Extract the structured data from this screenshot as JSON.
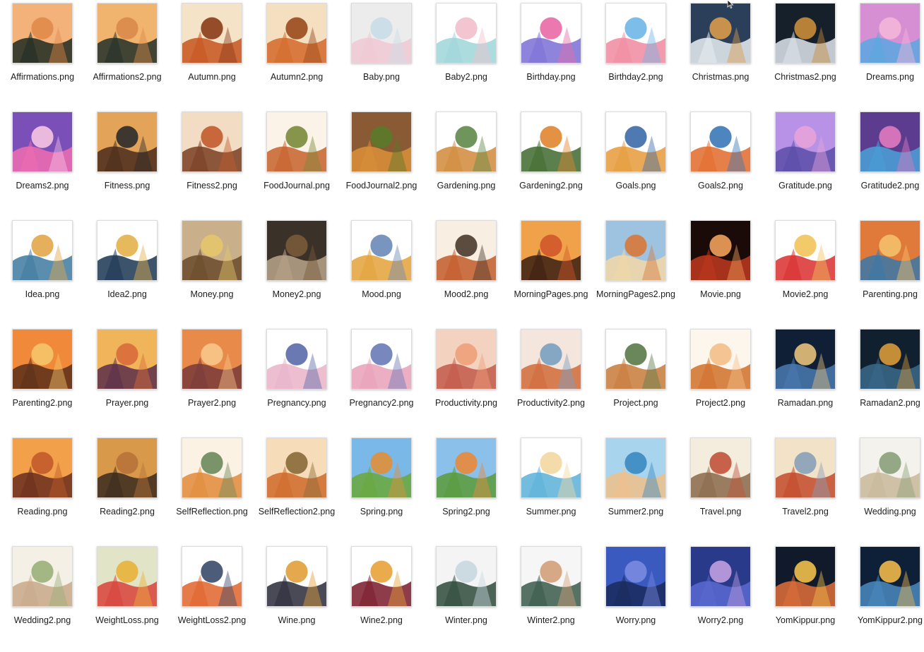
{
  "files": [
    {
      "name": "Affirmations.png",
      "c": [
        "#f2b27a",
        "#1e2a22",
        "#e08a4a"
      ]
    },
    {
      "name": "Affirmations2.png",
      "c": [
        "#f0b46e",
        "#223029",
        "#d9894a"
      ]
    },
    {
      "name": "Autumn.png",
      "c": [
        "#f5e3c8",
        "#c7531f",
        "#8a3b17"
      ]
    },
    {
      "name": "Autumn2.png",
      "c": [
        "#f4dfc1",
        "#d36a2a",
        "#9a4a1c"
      ]
    },
    {
      "name": "Baby.png",
      "c": [
        "#ececec",
        "#f0c9d3",
        "#c9dde8"
      ]
    },
    {
      "name": "Baby2.png",
      "c": [
        "#ffffff",
        "#9fd6d9",
        "#f2bfcc"
      ]
    },
    {
      "name": "Birthday.png",
      "c": [
        "#ffffff",
        "#7b6fd6",
        "#e96aa6"
      ]
    },
    {
      "name": "Birthday2.png",
      "c": [
        "#ffffff",
        "#f08aa0",
        "#6fb6e8"
      ]
    },
    {
      "name": "Christmas.png",
      "c": [
        "#2b3e5a",
        "#e9eef3",
        "#d99b4a"
      ]
    },
    {
      "name": "Christmas2.png",
      "c": [
        "#15202b",
        "#dfe6ec",
        "#c98c3a"
      ]
    },
    {
      "name": "Dreams.png",
      "c": [
        "#d78fd4",
        "#5aa8e0",
        "#f4b6da"
      ]
    },
    {
      "name": "Dreams2.png",
      "c": [
        "#7a4fb8",
        "#f06db0",
        "#f7c4e2"
      ]
    },
    {
      "name": "Fitness.png",
      "c": [
        "#e3a45a",
        "#4a2c1c",
        "#2b2b2b"
      ]
    },
    {
      "name": "Fitness2.png",
      "c": [
        "#f2dcc3",
        "#7a3e22",
        "#c35a2e"
      ]
    },
    {
      "name": "FoodJournal.png",
      "c": [
        "#fbf3e7",
        "#c6602a",
        "#7a8a3a"
      ]
    },
    {
      "name": "FoodJournal2.png",
      "c": [
        "#8a5a34",
        "#d9903a",
        "#5a7a2a"
      ]
    },
    {
      "name": "Gardening.png",
      "c": [
        "#ffffff",
        "#d08a3a",
        "#5f8a4a"
      ]
    },
    {
      "name": "Gardening2.png",
      "c": [
        "#ffffff",
        "#3f6a2e",
        "#e0852e"
      ]
    },
    {
      "name": "Goals.png",
      "c": [
        "#ffffff",
        "#e59a3a",
        "#3c6aa8"
      ]
    },
    {
      "name": "Goals2.png",
      "c": [
        "#ffffff",
        "#e26a2a",
        "#3a78b8"
      ]
    },
    {
      "name": "Gratitude.png",
      "c": [
        "#b892e6",
        "#5a4ea8",
        "#e7a3d8"
      ]
    },
    {
      "name": "Gratitude2.png",
      "c": [
        "#5c3c8e",
        "#4aa0d8",
        "#e07ac0"
      ]
    },
    {
      "name": "Idea.png",
      "c": [
        "#ffffff",
        "#3e7aa0",
        "#e2a64a"
      ]
    },
    {
      "name": "Idea2.png",
      "c": [
        "#ffffff",
        "#1a3552",
        "#e3b24a"
      ]
    },
    {
      "name": "Money.png",
      "c": [
        "#c9b08a",
        "#6a4a2a",
        "#e4c76a"
      ]
    },
    {
      "name": "Money2.png",
      "c": [
        "#3a3128",
        "#b9a48a",
        "#7a5a3a"
      ]
    },
    {
      "name": "Mood.png",
      "c": [
        "#ffffff",
        "#e3a23a",
        "#6a8ab8"
      ]
    },
    {
      "name": "Mood2.png",
      "c": [
        "#f8efe2",
        "#c25a2a",
        "#4a3a2e"
      ]
    },
    {
      "name": "MorningPages.png",
      "c": [
        "#f0a24a",
        "#3a1e12",
        "#d0562a"
      ]
    },
    {
      "name": "MorningPages2.png",
      "c": [
        "#9ec3e0",
        "#f2d8a6",
        "#d8783a"
      ]
    },
    {
      "name": "Movie.png",
      "c": [
        "#1a0a08",
        "#c0391e",
        "#f0a05a"
      ]
    },
    {
      "name": "Movie2.png",
      "c": [
        "#ffffff",
        "#d92e2e",
        "#f2c45a"
      ]
    },
    {
      "name": "Parenting.png",
      "c": [
        "#e07a3a",
        "#3a78a8",
        "#f3c06a"
      ]
    },
    {
      "name": "Parenting2.png",
      "c": [
        "#f08a3a",
        "#5a2e1a",
        "#f5c46a"
      ]
    },
    {
      "name": "Prayer.png",
      "c": [
        "#f0b45a",
        "#5a2e4a",
        "#d96a3a"
      ]
    },
    {
      "name": "Prayer2.png",
      "c": [
        "#e88a4a",
        "#7a3a3a",
        "#f7c68a"
      ]
    },
    {
      "name": "Pregnancy.png",
      "c": [
        "#ffffff",
        "#e9b3c8",
        "#5a6aa8"
      ]
    },
    {
      "name": "Pregnancy2.png",
      "c": [
        "#ffffff",
        "#e9a0b8",
        "#6a7ab8"
      ]
    },
    {
      "name": "Productivity.png",
      "c": [
        "#f3d2c0",
        "#c25a4a",
        "#f0a07a"
      ]
    },
    {
      "name": "Productivity2.png",
      "c": [
        "#f4e6dc",
        "#d06a3a",
        "#7aa0c0"
      ]
    },
    {
      "name": "Project.png",
      "c": [
        "#ffffff",
        "#c87a3a",
        "#5a7a4a"
      ]
    },
    {
      "name": "Project2.png",
      "c": [
        "#fdf6ec",
        "#d0702a",
        "#f3c08a"
      ]
    },
    {
      "name": "Ramadan.png",
      "c": [
        "#0e1f36",
        "#4a7ab0",
        "#e6c07a"
      ]
    },
    {
      "name": "Ramadan2.png",
      "c": [
        "#10202e",
        "#3a6a8a",
        "#d89a3a"
      ]
    },
    {
      "name": "Reading.png",
      "c": [
        "#f2a04a",
        "#6a2e1e",
        "#c25a2a"
      ]
    },
    {
      "name": "Reading2.png",
      "c": [
        "#d89a4a",
        "#3a2a1e",
        "#b8723a"
      ]
    },
    {
      "name": "SelfReflection.png",
      "c": [
        "#fbf2e4",
        "#e08a3a",
        "#6a8a5a"
      ]
    },
    {
      "name": "SelfReflection2.png",
      "c": [
        "#f6dcb8",
        "#d06a2a",
        "#8a6a3a"
      ]
    },
    {
      "name": "Spring.png",
      "c": [
        "#7ab8e8",
        "#6aa83a",
        "#e0903a"
      ]
    },
    {
      "name": "Spring2.png",
      "c": [
        "#8ac0ea",
        "#5a9a3a",
        "#e88a3a"
      ]
    },
    {
      "name": "Summer.png",
      "c": [
        "#ffffff",
        "#5ab0d8",
        "#f2d8a0"
      ]
    },
    {
      "name": "Summer2.png",
      "c": [
        "#a8d4ee",
        "#f0c08a",
        "#3a8ac0"
      ]
    },
    {
      "name": "Travel.png",
      "c": [
        "#f4ecdc",
        "#8a6a4a",
        "#c2533a"
      ]
    },
    {
      "name": "Travel2.png",
      "c": [
        "#f2e2c8",
        "#c24a2a",
        "#8aa0b8"
      ]
    },
    {
      "name": "Wedding.png",
      "c": [
        "#f4f2ec",
        "#c8b89a",
        "#8aa07a"
      ]
    },
    {
      "name": "Wedding2.png",
      "c": [
        "#f5f0e6",
        "#c8a888",
        "#9ab07a"
      ]
    },
    {
      "name": "WeightLoss.png",
      "c": [
        "#e2e4c8",
        "#d8423a",
        "#e8b23a"
      ]
    },
    {
      "name": "WeightLoss2.png",
      "c": [
        "#ffffff",
        "#e0632a",
        "#3a4a6a"
      ]
    },
    {
      "name": "Wine.png",
      "c": [
        "#ffffff",
        "#2a2a3a",
        "#e2a03a"
      ]
    },
    {
      "name": "Wine2.png",
      "c": [
        "#ffffff",
        "#7a1a2a",
        "#e8a23a"
      ]
    },
    {
      "name": "Winter.png",
      "c": [
        "#f4f4f4",
        "#2e4a3a",
        "#c8d8e0"
      ]
    },
    {
      "name": "Winter2.png",
      "c": [
        "#f6f6f6",
        "#3a5a4a",
        "#d4a07a"
      ]
    },
    {
      "name": "Worry.png",
      "c": [
        "#3a5ac0",
        "#1a2a5a",
        "#7a8ae0"
      ]
    },
    {
      "name": "Worry2.png",
      "c": [
        "#2a3a8a",
        "#5a6ad0",
        "#c0a0e0"
      ]
    },
    {
      "name": "YomKippur.png",
      "c": [
        "#101a2a",
        "#e0703a",
        "#f2c04a"
      ]
    },
    {
      "name": "YomKippur2.png",
      "c": [
        "#0e2038",
        "#4a8ac0",
        "#f0b84a"
      ]
    }
  ]
}
